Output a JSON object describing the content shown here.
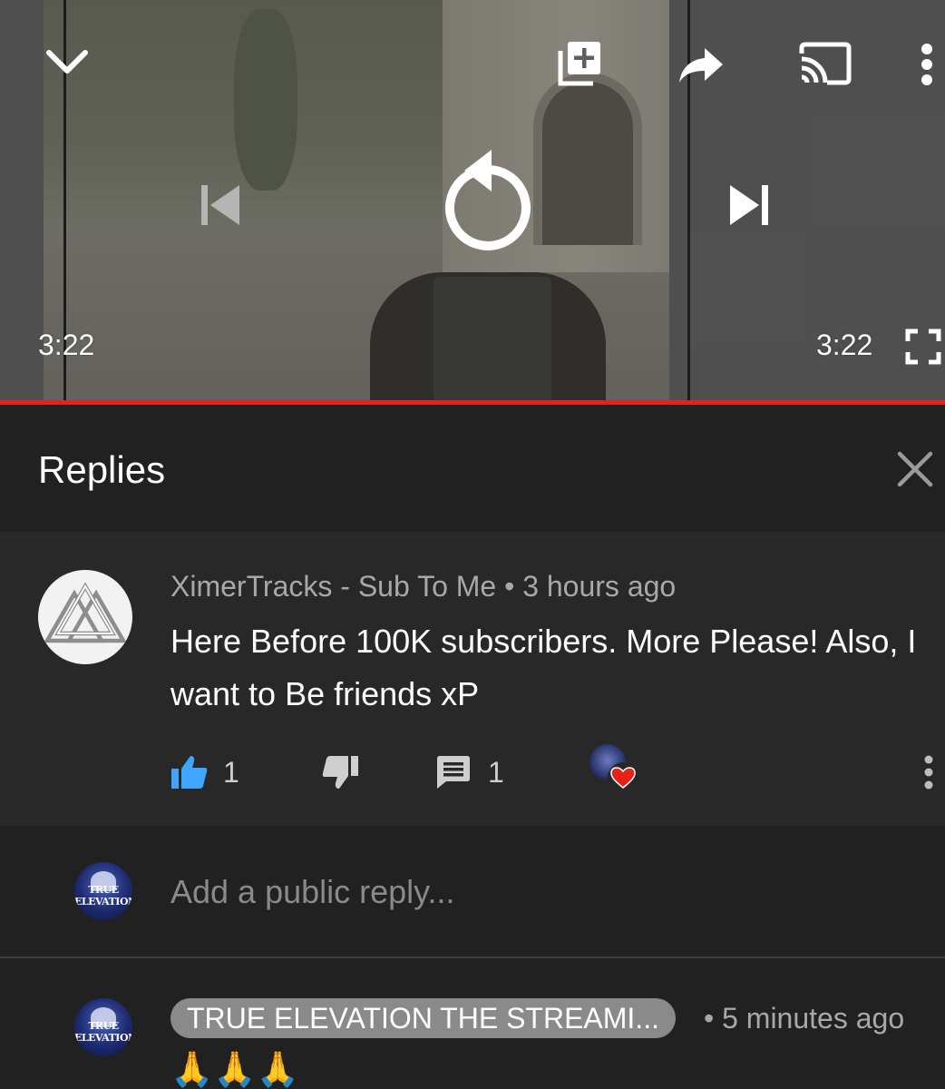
{
  "player": {
    "time_current": "3:22",
    "time_total": "3:22",
    "progress": 1.0,
    "accent_color": "#e52222",
    "icons": [
      "chevron-down-icon",
      "add-to-queue-icon",
      "share-icon",
      "cast-icon",
      "more-vert-icon",
      "skip-previous-icon",
      "replay-icon",
      "skip-next-icon",
      "fullscreen-icon"
    ]
  },
  "panel": {
    "title": "Replies",
    "close_icon": "close-icon"
  },
  "comment": {
    "author": "XimerTracks - Sub To Me",
    "separator": "•",
    "time": "3 hours ago",
    "text": "Here Before 100K subscribers. More Please! Also, I want to Be friends xP",
    "like_count": "1",
    "reply_count": "1",
    "like_color": "#3ea6ff",
    "heart_color": "#e62117"
  },
  "reply_input": {
    "placeholder": "Add a public reply..."
  },
  "reply": {
    "author": "TRUE ELEVATION THE STREAMI...",
    "separator": "•",
    "time": "5 minutes ago",
    "text": "🙏🙏🙏",
    "avatar_text": "TRUE ELEVATION"
  }
}
